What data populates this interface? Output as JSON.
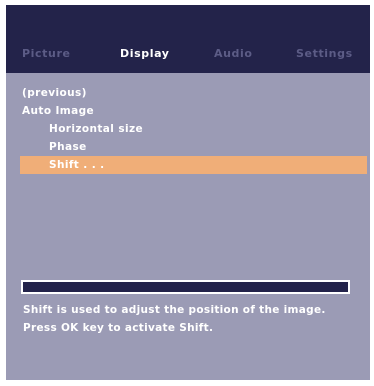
{
  "tabs": [
    {
      "label": "Picture",
      "active": false
    },
    {
      "label": "Display",
      "active": true
    },
    {
      "label": "Audio",
      "active": false
    },
    {
      "label": "Settings",
      "active": false
    }
  ],
  "menu": {
    "items": [
      {
        "label": "(previous)",
        "level": 0,
        "selected": false
      },
      {
        "label": "Auto Image",
        "level": 0,
        "selected": false
      },
      {
        "label": "Horizontal size",
        "level": 1,
        "selected": false
      },
      {
        "label": "Phase",
        "level": 1,
        "selected": false
      },
      {
        "label": "Shift . . .",
        "level": 1,
        "selected": true
      }
    ]
  },
  "help": {
    "line1": "Shift is used to adjust the position of the image.",
    "line2": "Press OK key to activate Shift."
  },
  "colors": {
    "panel_background": "#9b9bb5",
    "top_bar": "#23234a",
    "inactive_tab": "#5c5c86",
    "active_tab": "#ffffff",
    "selection_highlight": "#f0ae78",
    "text": "#ffffff"
  }
}
